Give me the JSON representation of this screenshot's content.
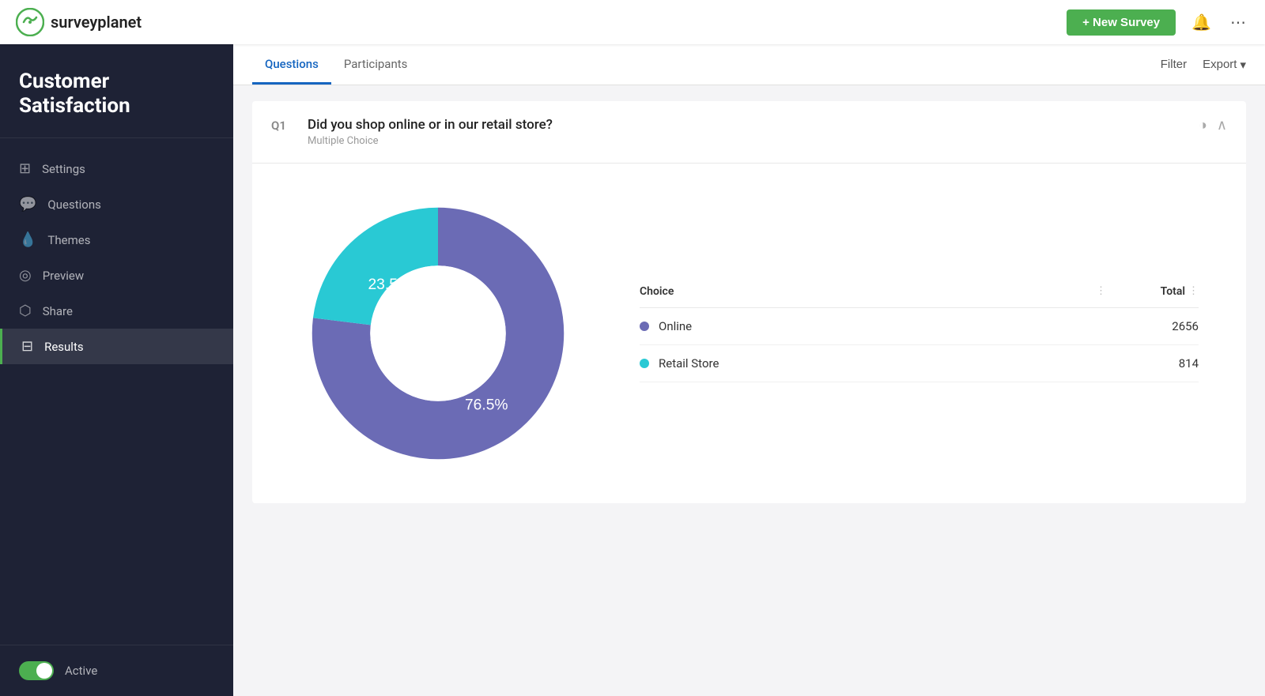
{
  "app": {
    "name": "surveyplanet"
  },
  "header": {
    "new_survey_label": "+ New Survey"
  },
  "sidebar": {
    "survey_title": "Customer Satisfaction",
    "items": [
      {
        "id": "settings",
        "label": "Settings",
        "icon": "⊞",
        "active": false
      },
      {
        "id": "questions",
        "label": "Questions",
        "icon": "💬",
        "active": false
      },
      {
        "id": "themes",
        "label": "Themes",
        "icon": "💧",
        "active": false
      },
      {
        "id": "preview",
        "label": "Preview",
        "icon": "◎",
        "active": false
      },
      {
        "id": "share",
        "label": "Share",
        "icon": "⬡",
        "active": false
      },
      {
        "id": "results",
        "label": "Results",
        "icon": "⊟",
        "active": true
      }
    ],
    "active_label": "Active",
    "toggle_on": true
  },
  "tabs": [
    {
      "id": "questions",
      "label": "Questions",
      "active": true
    },
    {
      "id": "participants",
      "label": "Participants",
      "active": false
    }
  ],
  "tab_actions": {
    "filter_label": "Filter",
    "export_label": "Export"
  },
  "question": {
    "number": "Q1",
    "text": "Did you shop online or in our retail store?",
    "subtext": "Multiple Choice"
  },
  "chart": {
    "segments": [
      {
        "label": "Online",
        "value": 76.5,
        "color": "#6b6bb5",
        "count": 2656
      },
      {
        "label": "Retail Store",
        "value": 23.5,
        "color": "#29c9d4",
        "count": 814
      }
    ]
  }
}
